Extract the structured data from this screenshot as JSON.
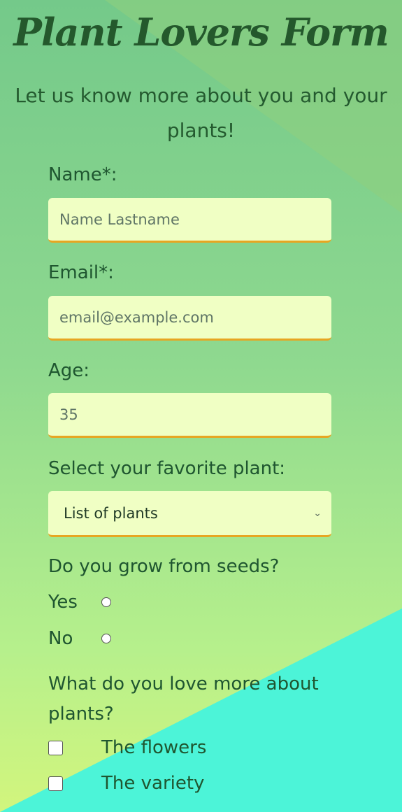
{
  "form": {
    "title": "Plant Lovers Form",
    "subtitle": "Let us know more about you and your plants!"
  },
  "fields": {
    "name_label": "Name*:",
    "name_placeholder": "Name Lastname",
    "email_label": "Email*:",
    "email_placeholder": "email@example.com",
    "age_label": "Age:",
    "age_placeholder": "35",
    "plant_label": "Select your favorite plant:",
    "plant_selected": "List of plants"
  },
  "seeds": {
    "question": "Do you grow from seeds?",
    "options": [
      "Yes",
      "No"
    ]
  },
  "love": {
    "question": "What do you love more about plants?",
    "options": [
      "The flowers",
      "The variety"
    ]
  },
  "colors": {
    "input_bg": "#f0ffc4",
    "input_border": "#e7a622",
    "text": "#1f5630",
    "accent_teal": "#4cf4d8"
  }
}
